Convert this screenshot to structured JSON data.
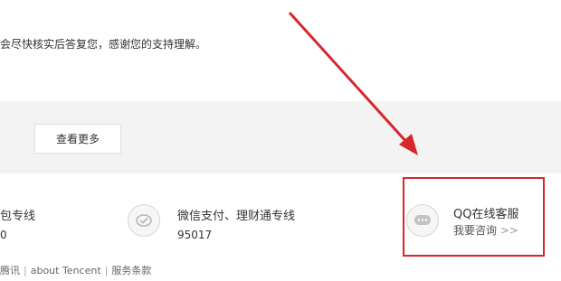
{
  "message": "会尽快核实后答复您，感谢您的支持理解。",
  "view_more_label": "查看更多",
  "hotlines": [
    {
      "title": "包专线",
      "number": "0",
      "icon": "phone-icon"
    },
    {
      "title": "微信支付、理财通专线",
      "number": "95017",
      "icon": "wechat-pay-icon"
    }
  ],
  "qq_service": {
    "title": "QQ在线客服",
    "link": "我要咨询",
    "link_suffix": ">>",
    "icon": "chat-bubble-icon"
  },
  "footer": {
    "items": [
      "腾讯",
      "about Tencent",
      "服务条款"
    ],
    "separator": "|"
  },
  "annotation": {
    "arrow_color": "#d6272b",
    "box_color": "#d6272b"
  }
}
